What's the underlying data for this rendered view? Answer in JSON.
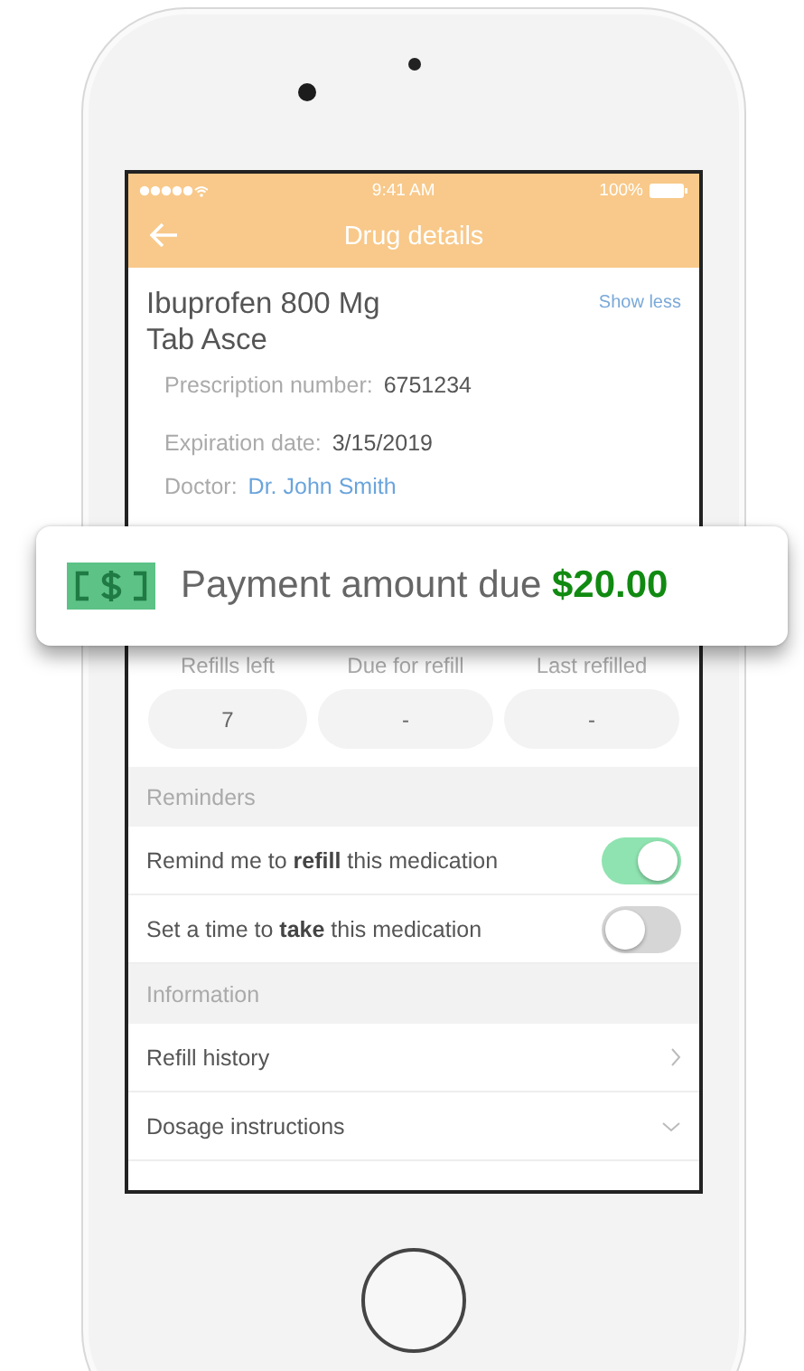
{
  "status_bar": {
    "time": "9:41 AM",
    "battery": "100%"
  },
  "nav": {
    "title": "Drug details"
  },
  "drug": {
    "name": "Ibuprofen 800 Mg Tab Asce",
    "toggle_link": "Show less"
  },
  "details": [
    {
      "label": "Prescription number:",
      "value": "6751234",
      "kind": "text"
    },
    {
      "label": "Expiration date:",
      "value": "3/15/2019",
      "kind": "text"
    },
    {
      "label": "Doctor:",
      "value": "Dr. John Smith",
      "kind": "link"
    }
  ],
  "payment": {
    "label": "Payment amount due",
    "amount": "$20.00"
  },
  "refill_stats": [
    {
      "label": "Refills left",
      "value": "7"
    },
    {
      "label": "Due for refill",
      "value": "-"
    },
    {
      "label": "Last refilled",
      "value": "-"
    }
  ],
  "sections": [
    {
      "title": "Reminders",
      "rows": [
        {
          "kind": "toggle",
          "text": "Remind me to **refill** this medication",
          "on": true
        },
        {
          "kind": "toggle",
          "text": "Set a time to **take** this medication",
          "on": false
        }
      ]
    },
    {
      "title": "Information",
      "rows": [
        {
          "kind": "navigate",
          "text": "Refill history"
        },
        {
          "kind": "expandable",
          "text": "Dosage instructions",
          "expanded": false
        }
      ]
    }
  ]
}
